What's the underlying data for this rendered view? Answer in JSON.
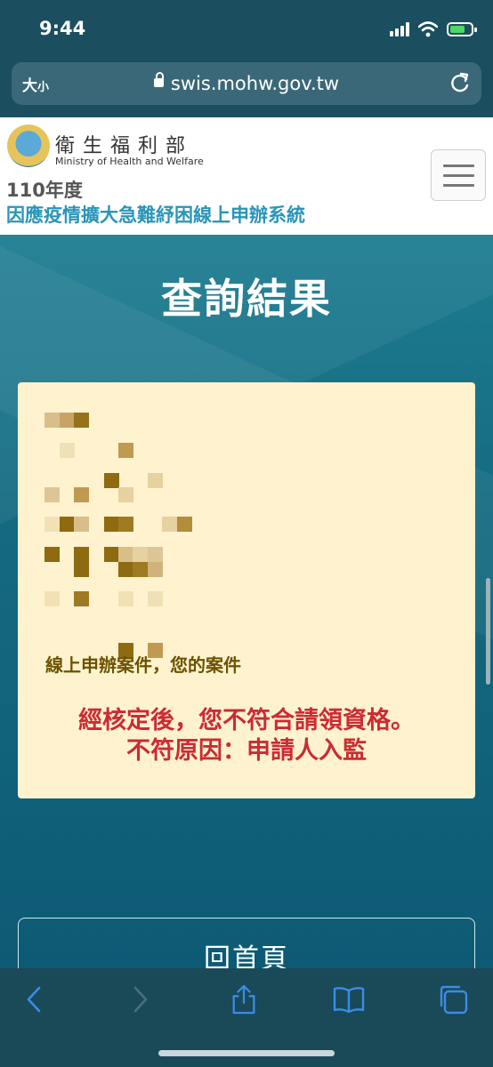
{
  "status_bar": {
    "time": "9:44"
  },
  "browser": {
    "text_size_label": "大",
    "text_size_small": "小",
    "url": "swis.mohw.gov.tw"
  },
  "site": {
    "ministry_name": "衛生福利部",
    "ministry_name_en": "Ministry of Health and Welfare",
    "year": "110年度",
    "system_name": "因應疫情擴大急難紓困線上申辦系統"
  },
  "main": {
    "title": "查詢結果",
    "case_line": "線上申辦案件，您的案件",
    "verdict_line1": "經核定後，您不符合請領資格。",
    "verdict_line2": "不符原因：申請人入監",
    "home_button": "回首頁"
  },
  "colors": {
    "accent": "#2a95b8",
    "verdict": "#cc2b33",
    "card_bg": "#fff3cf"
  }
}
